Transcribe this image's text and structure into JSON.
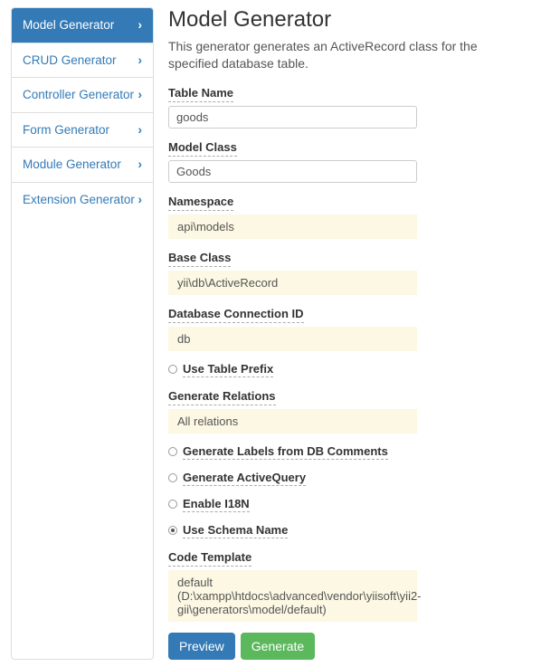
{
  "sidebar": {
    "items": [
      {
        "label": "Model Generator",
        "active": true
      },
      {
        "label": "CRUD Generator",
        "active": false
      },
      {
        "label": "Controller Generator",
        "active": false
      },
      {
        "label": "Form Generator",
        "active": false
      },
      {
        "label": "Module Generator",
        "active": false
      },
      {
        "label": "Extension Generator",
        "active": false
      }
    ]
  },
  "main": {
    "title": "Model Generator",
    "description": "This generator generates an ActiveRecord class for the specified database table.",
    "fields": {
      "table_name": {
        "label": "Table Name",
        "value": "goods"
      },
      "model_class": {
        "label": "Model Class",
        "value": "Goods"
      },
      "namespace": {
        "label": "Namespace",
        "value": "api\\models"
      },
      "base_class": {
        "label": "Base Class",
        "value": "yii\\db\\ActiveRecord"
      },
      "db_conn": {
        "label": "Database Connection ID",
        "value": "db"
      },
      "use_table_prefix": {
        "label": "Use Table Prefix",
        "checked": false
      },
      "generate_relations": {
        "label": "Generate Relations",
        "value": "All relations"
      },
      "gen_labels": {
        "label": "Generate Labels from DB Comments",
        "checked": false
      },
      "gen_aq": {
        "label": "Generate ActiveQuery",
        "checked": false
      },
      "enable_i18n": {
        "label": "Enable I18N",
        "checked": false
      },
      "use_schema": {
        "label": "Use Schema Name",
        "checked": true
      },
      "code_template": {
        "label": "Code Template",
        "value": "default (D:\\xampp\\htdocs\\advanced\\vendor\\yiisoft\\yii2-gii\\generators\\model/default)"
      }
    },
    "buttons": {
      "preview": "Preview",
      "generate": "Generate"
    }
  }
}
